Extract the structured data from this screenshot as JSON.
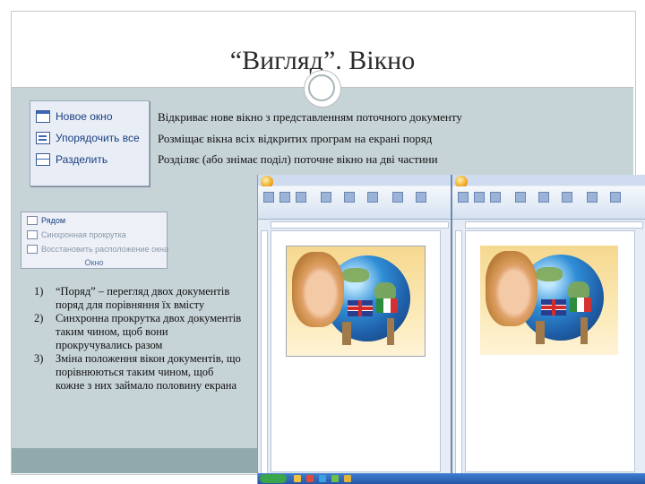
{
  "slide": {
    "title": "“Вигляд”. Вікно",
    "accent": "#c6d3d7",
    "footer_color": "#8fa9ad"
  },
  "ribbon_window": {
    "items": [
      {
        "label": "Новое окно",
        "icon": "new-window-icon"
      },
      {
        "label": "Упорядочить все",
        "icon": "arrange-all-icon"
      },
      {
        "label": "Разделить",
        "icon": "split-icon"
      }
    ]
  },
  "descriptions": [
    "Відкриває нове вікно з представленням поточного документу",
    "Розміщає вікна всіх відкритих програм на екрані поряд",
    "Розділяє (або знімає поділ) поточне вікно на дві частини"
  ],
  "ribbon_compare": {
    "items": [
      {
        "label": "Рядом",
        "icon": "side-by-side-icon"
      },
      {
        "label": "Синхронная прокрутка",
        "icon": "sync-scroll-icon"
      },
      {
        "label": "Восстановить расположение окна",
        "icon": "reset-position-icon"
      }
    ],
    "group_label": "Окно"
  },
  "list": [
    {
      "num": "1)",
      "text": "“Поряд” – перегляд двох документів поряд для порівняння їх вмісту"
    },
    {
      "num": "2)",
      "text": "Синхронна прокрутка двох документів таким чином, щоб вони прокручувались разом"
    },
    {
      "num": "3)",
      "text": "Зміна положення вікон документів, що порівнюються таким чином, щоб кожне з них займало половину екрана"
    }
  ]
}
